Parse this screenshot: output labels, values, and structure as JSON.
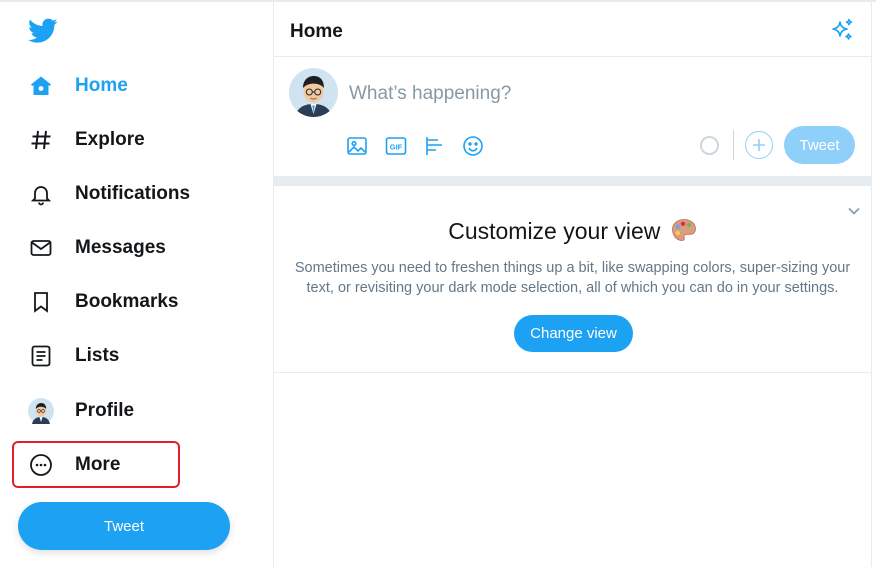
{
  "sidebar": {
    "logo": "twitter-bird-icon",
    "items": [
      {
        "label": "Home",
        "icon": "home-icon",
        "active": true
      },
      {
        "label": "Explore",
        "icon": "hashtag-icon"
      },
      {
        "label": "Notifications",
        "icon": "bell-icon"
      },
      {
        "label": "Messages",
        "icon": "envelope-icon"
      },
      {
        "label": "Bookmarks",
        "icon": "bookmark-icon"
      },
      {
        "label": "Lists",
        "icon": "list-icon"
      },
      {
        "label": "Profile",
        "icon": "avatar"
      },
      {
        "label": "More",
        "icon": "more-circle-icon",
        "highlighted": true
      }
    ],
    "tweet_button": "Tweet"
  },
  "main": {
    "header": {
      "title": "Home",
      "icon": "sparkle-icon"
    },
    "composer": {
      "placeholder": "What’s happening?",
      "tools": [
        "image-icon",
        "gif-icon",
        "poll-icon",
        "emoji-icon"
      ],
      "gif_label": "GIF",
      "tweet_button": "Tweet"
    },
    "card": {
      "title": "Customize your view",
      "title_emoji": "palette-icon",
      "text": "Sometimes you need to freshen things up a bit, like swapping colors, super-sizing your text, or revisiting your dark mode selection, all of which you can do in your settings.",
      "button": "Change view"
    }
  },
  "colors": {
    "accent": "#1da1f2",
    "accent_disabled": "#8ed0f9",
    "highlight": "#e0202b",
    "border": "#e6ecf0"
  }
}
